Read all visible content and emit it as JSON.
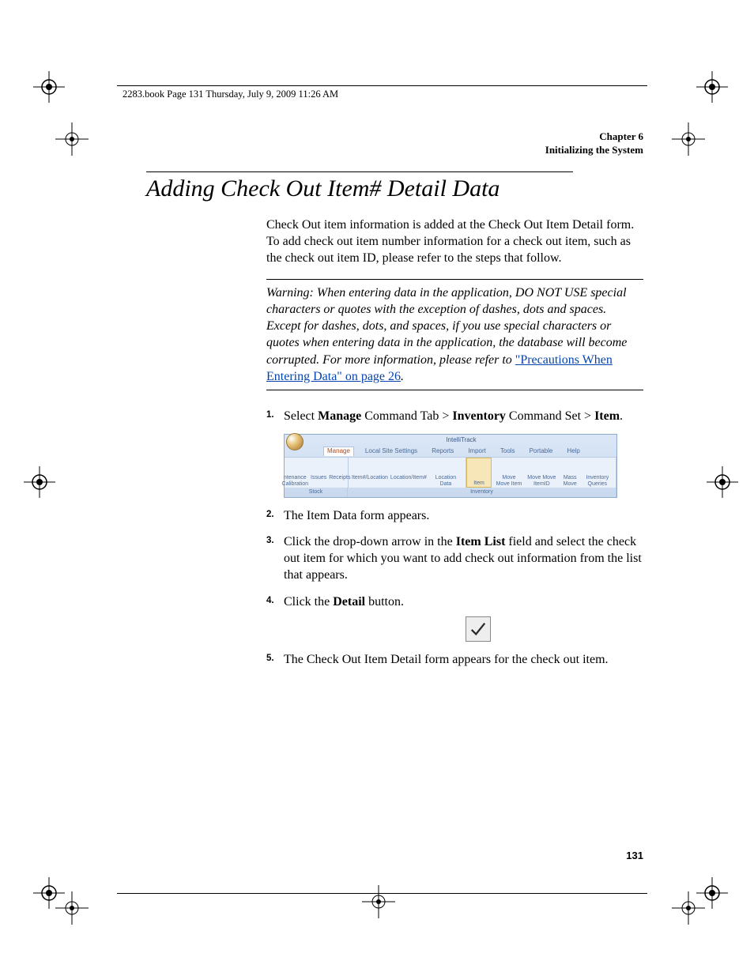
{
  "header": {
    "crop_text": "2283.book  Page 131  Thursday, July 9, 2009  11:26 AM"
  },
  "chapter": {
    "label_line1": "Chapter 6",
    "label_line2": "Initializing the System"
  },
  "section_title": "Adding Check Out Item# Detail Data",
  "intro": "Check Out item information is added at the Check Out Item Detail form. To add check out item number information for a check out item, such as the check out item ID, please refer to the steps that follow.",
  "warning": {
    "prefix": "Warning:   When entering data in the application, DO NOT USE special characters or quotes with the exception of dashes, dots and spaces. Except for dashes, dots, and spaces, if you use special characters or quotes when entering data in the application, the database will become corrupted. For more information, please refer to ",
    "link_text": "\"Precautions When Entering Data\" on page 26",
    "suffix": "."
  },
  "steps": [
    {
      "num": "1.",
      "parts": [
        "Select ",
        "Manage",
        " Command Tab > ",
        "Inventory",
        " Command Set > ",
        "Item",
        "."
      ]
    },
    {
      "num": "2.",
      "text": "The Item Data form appears."
    },
    {
      "num": "3.",
      "parts": [
        "Click the drop-down arrow in the ",
        "Item List",
        " field and select the check out item for which you want to add check out information from the list that appears."
      ]
    },
    {
      "num": "4.",
      "parts": [
        "Click the ",
        "Detail",
        " button."
      ]
    },
    {
      "num": "5.",
      "text": "The Check Out Item Detail form appears for the check out item."
    }
  ],
  "ribbon": {
    "title": "IntelliTrack",
    "tabs": [
      "Manage",
      "Local Site Settings",
      "Reports",
      "Import",
      "Tools",
      "Portable",
      "Help"
    ],
    "group_stock": {
      "items": [
        "ntenance Calibration",
        "Issues",
        "Receipts"
      ],
      "label": "Stock"
    },
    "group_inventory": {
      "items": [
        "Item#/Location",
        "Location/Item#",
        "Location Data",
        "Item",
        "Move Move Item",
        "Move Move ItemID",
        "Mass Move",
        "Inventory Queries"
      ],
      "label": "Inventory"
    }
  },
  "page_number": "131"
}
